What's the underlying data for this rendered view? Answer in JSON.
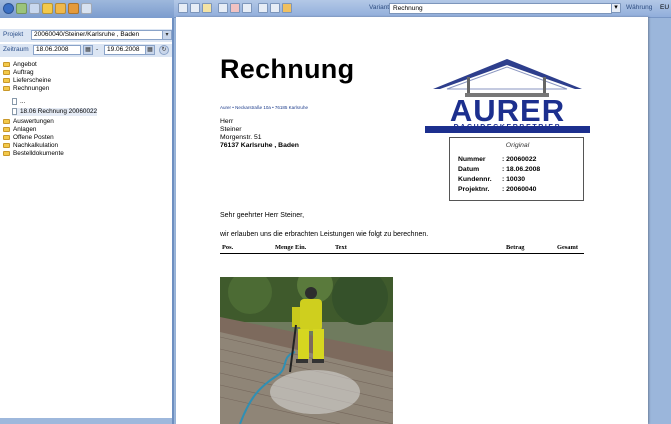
{
  "left": {
    "projekt": {
      "label": "Projekt",
      "value": "20060040/Steiner/Karlsruhe , Baden"
    },
    "zeitraum": {
      "label": "Zeitraum",
      "from": "18.06.2008",
      "to": "19.06.2008"
    },
    "tree": [
      {
        "label": "Angebot",
        "icon": "folder"
      },
      {
        "label": "Auftrag",
        "icon": "folder"
      },
      {
        "label": "Lieferscheine",
        "icon": "folder"
      },
      {
        "label": "Rechnungen",
        "icon": "folder"
      },
      {
        "label": "...",
        "icon": "doc"
      },
      {
        "label": "18.06 Rechnung 20060022",
        "icon": "doc"
      },
      {
        "label": "Auswertungen",
        "icon": "folder"
      },
      {
        "label": "Anlagen",
        "icon": "folder"
      },
      {
        "label": "Offene Posten",
        "icon": "folder"
      },
      {
        "label": "Nachkalkulation",
        "icon": "folder"
      },
      {
        "label": "Bestelldokumente",
        "icon": "folder"
      }
    ]
  },
  "right": {
    "variante_label": "Variante",
    "variante_value": "Rechnung",
    "waehrung_label": "Währung",
    "waehrung_value": "EU"
  },
  "document": {
    "title": "Rechnung",
    "sender_line": "Aurer • Neckarstraße 10a • 76185 Karlsruhe",
    "address": [
      "Herr",
      "Steiner",
      "Morgenstr. 51",
      "76137 Karlsruhe , Baden"
    ],
    "logo_name": "AURER",
    "logo_sub": "DACHDECKERBETRIEB",
    "info": {
      "title": "Original",
      "rows": [
        {
          "key": "Nummer",
          "value": ": 20060022"
        },
        {
          "key": "Datum",
          "value": ": 18.06.2008"
        },
        {
          "key": "Kundennr.",
          "value": ": 10030"
        },
        {
          "key": "Projektnr.",
          "value": ": 20060040"
        }
      ]
    },
    "greeting": "Sehr geehrter Herr Steiner,",
    "intro": "wir erlauben uns die erbrachten Leistungen wie folgt zu berechnen.",
    "columns": [
      "Pos.",
      "Menge Ein.",
      "Text",
      "Betrag",
      "Gesamt"
    ]
  },
  "colors": {
    "accent": "#7b9cce",
    "logo": "#1c2f8e",
    "pane_bg": "#9bb6db"
  }
}
